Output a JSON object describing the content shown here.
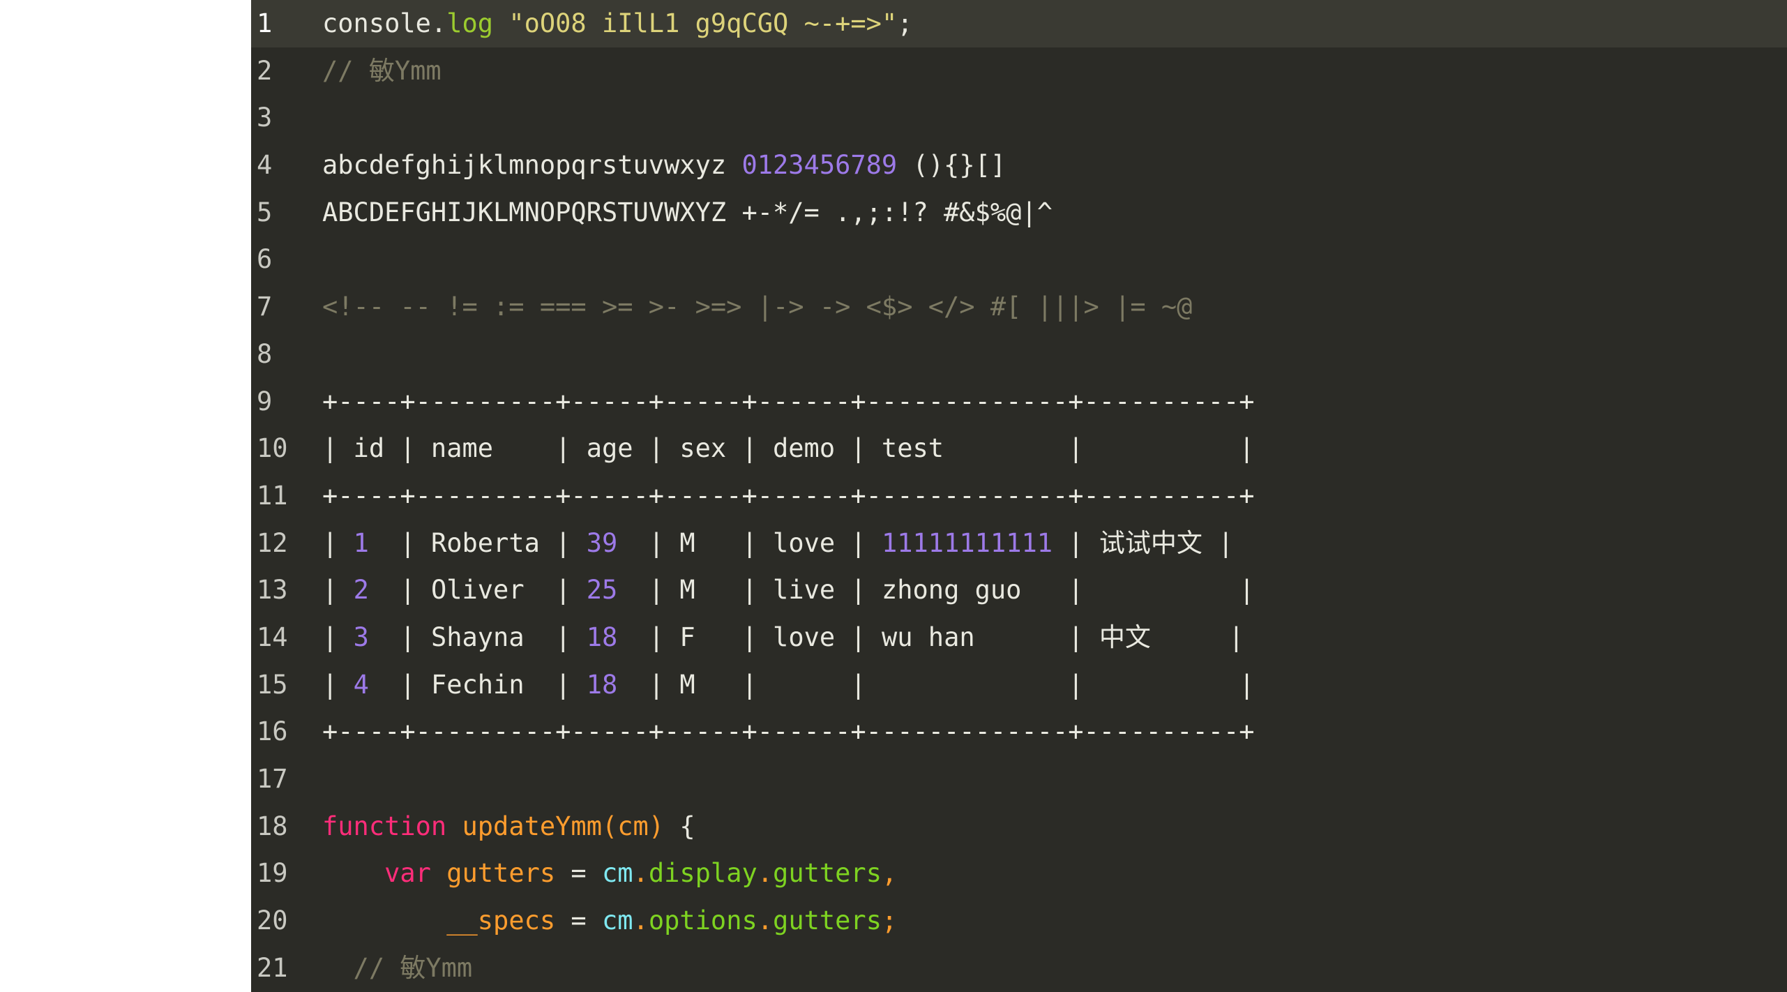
{
  "editor": {
    "name": "code-editor",
    "theme_colors": {
      "background": "#2b2b26",
      "active_line_background": "#3a3a33",
      "page_margin": "#ffffff",
      "gutter_text": "#c9c9c2",
      "default_text": "#e9e9e0",
      "function_green": "#9ccc2f",
      "string_yellow": "#ddd37a",
      "number_purple": "#9d7ae8",
      "comment_olive": "#7d7a63",
      "keyword_pink": "#ff2d7a",
      "identifier_orange": "#ff9d2e",
      "variable_cyan": "#7fe8f0",
      "property_green": "#7ed321"
    },
    "active_line": 1,
    "lines": [
      {
        "number": "1",
        "active": true,
        "tokens": [
          {
            "text": "console.",
            "type": "plain"
          },
          {
            "text": "log",
            "type": "fn"
          },
          {
            "text": " ",
            "type": "plain"
          },
          {
            "text": "\"oO08 iIlL1 g9qCGQ ~-+=>\"",
            "type": "string"
          },
          {
            "text": ";",
            "type": "punct"
          }
        ]
      },
      {
        "number": "2",
        "active": false,
        "tokens": [
          {
            "text": "// 敏Ymm",
            "type": "comment"
          }
        ]
      },
      {
        "number": "3",
        "active": false,
        "tokens": []
      },
      {
        "number": "4",
        "active": false,
        "tokens": [
          {
            "text": "abcdefghijklmnopqrstuvwxyz ",
            "type": "plain"
          },
          {
            "text": "0123456789",
            "type": "number"
          },
          {
            "text": " (){}[]",
            "type": "plain"
          }
        ]
      },
      {
        "number": "5",
        "active": false,
        "tokens": [
          {
            "text": "ABCDEFGHIJKLMNOPQRSTUVWXYZ +-*/= .,;:!? #&$%@|^",
            "type": "plain"
          }
        ]
      },
      {
        "number": "6",
        "active": false,
        "tokens": []
      },
      {
        "number": "7",
        "active": false,
        "tokens": [
          {
            "text": "<!-- -- != := === >= >- >=> |-> -> <$> </> #[ |||> |= ~@",
            "type": "lig"
          }
        ]
      },
      {
        "number": "8",
        "active": false,
        "tokens": []
      },
      {
        "number": "9",
        "active": false,
        "tokens": [
          {
            "text": "+----+---------+-----+-----+------+-------------+----------+",
            "type": "plain"
          }
        ]
      },
      {
        "number": "10",
        "active": false,
        "tokens": [
          {
            "text": "| id | name    | age | sex | demo | test        |          |",
            "type": "plain"
          }
        ]
      },
      {
        "number": "11",
        "active": false,
        "tokens": [
          {
            "text": "+----+---------+-----+-----+------+-------------+----------+",
            "type": "plain"
          }
        ]
      },
      {
        "number": "12",
        "active": false,
        "tokens": [
          {
            "text": "| ",
            "type": "plain"
          },
          {
            "text": "1",
            "type": "number"
          },
          {
            "text": "  | Roberta | ",
            "type": "plain"
          },
          {
            "text": "39",
            "type": "number"
          },
          {
            "text": "  | M   | love | ",
            "type": "plain"
          },
          {
            "text": "11111111111",
            "type": "number"
          },
          {
            "text": " | 试试中文 |",
            "type": "plain"
          }
        ]
      },
      {
        "number": "13",
        "active": false,
        "tokens": [
          {
            "text": "| ",
            "type": "plain"
          },
          {
            "text": "2",
            "type": "number"
          },
          {
            "text": "  | Oliver  | ",
            "type": "plain"
          },
          {
            "text": "25",
            "type": "number"
          },
          {
            "text": "  | M   | live | zhong guo   |          |",
            "type": "plain"
          }
        ]
      },
      {
        "number": "14",
        "active": false,
        "tokens": [
          {
            "text": "| ",
            "type": "plain"
          },
          {
            "text": "3",
            "type": "number"
          },
          {
            "text": "  | Shayna  | ",
            "type": "plain"
          },
          {
            "text": "18",
            "type": "number"
          },
          {
            "text": "  | F   | love | wu han      | 中文     |",
            "type": "plain"
          }
        ]
      },
      {
        "number": "15",
        "active": false,
        "tokens": [
          {
            "text": "| ",
            "type": "plain"
          },
          {
            "text": "4",
            "type": "number"
          },
          {
            "text": "  | Fechin  | ",
            "type": "plain"
          },
          {
            "text": "18",
            "type": "number"
          },
          {
            "text": "  | M   |      |             |          |",
            "type": "plain"
          }
        ]
      },
      {
        "number": "16",
        "active": false,
        "tokens": [
          {
            "text": "+----+---------+-----+-----+------+-------------+----------+",
            "type": "plain"
          }
        ]
      },
      {
        "number": "17",
        "active": false,
        "tokens": []
      },
      {
        "number": "18",
        "active": false,
        "tokens": [
          {
            "text": "function",
            "type": "keyword"
          },
          {
            "text": " ",
            "type": "plain"
          },
          {
            "text": "updateYmm",
            "type": "ident"
          },
          {
            "text": "(",
            "type": "ident"
          },
          {
            "text": "cm",
            "type": "ident"
          },
          {
            "text": ")",
            "type": "ident"
          },
          {
            "text": " {",
            "type": "plain"
          }
        ]
      },
      {
        "number": "19",
        "active": false,
        "tokens": [
          {
            "text": "    ",
            "type": "plain"
          },
          {
            "text": "var",
            "type": "keyword"
          },
          {
            "text": " ",
            "type": "plain"
          },
          {
            "text": "gutters",
            "type": "ident"
          },
          {
            "text": " = ",
            "type": "op"
          },
          {
            "text": "cm",
            "type": "varcyan"
          },
          {
            "text": ".",
            "type": "ident"
          },
          {
            "text": "display",
            "type": "prop"
          },
          {
            "text": ".",
            "type": "ident"
          },
          {
            "text": "gutters",
            "type": "prop"
          },
          {
            "text": ",",
            "type": "ident"
          }
        ]
      },
      {
        "number": "20",
        "active": false,
        "tokens": [
          {
            "text": "        ",
            "type": "plain"
          },
          {
            "text": "__specs",
            "type": "ident"
          },
          {
            "text": " = ",
            "type": "op"
          },
          {
            "text": "cm",
            "type": "varcyan"
          },
          {
            "text": ".",
            "type": "ident"
          },
          {
            "text": "options",
            "type": "prop"
          },
          {
            "text": ".",
            "type": "ident"
          },
          {
            "text": "gutters",
            "type": "prop"
          },
          {
            "text": ";",
            "type": "ident"
          }
        ]
      },
      {
        "number": "21",
        "active": false,
        "tokens": [
          {
            "text": "  // 敏Ymm",
            "type": "comment"
          }
        ]
      }
    ]
  }
}
